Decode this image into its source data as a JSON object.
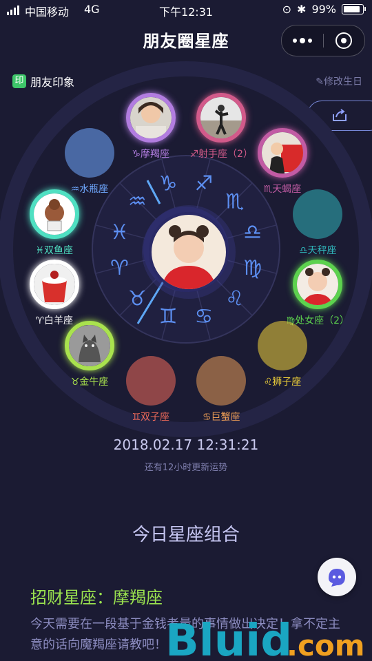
{
  "status": {
    "carrier": "中国移动",
    "network": "4G",
    "time": "下午12:31",
    "battery": "99%"
  },
  "nav": {
    "title": "朋友圈星座"
  },
  "header": {
    "impression_icon": "印",
    "impression_label": "朋友印象",
    "edit_birthday": "修改生日"
  },
  "wheel": {
    "inner_glyphs": [
      "♑",
      "♐",
      "♏",
      "♎",
      "♍",
      "♌",
      "♋",
      "♊",
      "♉",
      "♈",
      "♓",
      "♒"
    ],
    "signs": [
      {
        "key": "capricorn",
        "label": "♑摩羯座",
        "color": "#b27de0",
        "photo": "girl"
      },
      {
        "key": "sagittarius",
        "label": "♐射手座（2）",
        "color": "#d25a8a",
        "photo": "dance"
      },
      {
        "key": "scorpio",
        "label": "♏天蝎座",
        "color": "#c25ba4",
        "photo": "red"
      },
      {
        "key": "libra",
        "label": "♎天秤座",
        "color": "#2fb3b8",
        "photo": ""
      },
      {
        "key": "virgo",
        "label": "♍处女座（2）",
        "color": "#5dd24e",
        "photo": "red-girl"
      },
      {
        "key": "leo",
        "label": "♌狮子座",
        "color": "#f0d23a",
        "photo": ""
      },
      {
        "key": "cancer",
        "label": "♋巨蟹座",
        "color": "#e89a55",
        "photo": ""
      },
      {
        "key": "gemini",
        "label": "♊双子座",
        "color": "#ee6a5a",
        "photo": ""
      },
      {
        "key": "taurus",
        "label": "♉金牛座",
        "color": "#a9e24e",
        "photo": "cat"
      },
      {
        "key": "aries",
        "label": "♈白羊座",
        "color": "#ffffff",
        "photo": "cup"
      },
      {
        "key": "pisces",
        "label": "♓双鱼座",
        "color": "#4fe0c2",
        "photo": "hair"
      },
      {
        "key": "aquarius",
        "label": "♒水瓶座",
        "color": "#6fa8ff",
        "photo": ""
      }
    ]
  },
  "info": {
    "datetime": "2018.02.17 12:31:21",
    "update": "还有12小时更新运势"
  },
  "today": {
    "section_title": "今日星座组合",
    "fortune_title": "招财星座：摩羯座",
    "fortune_body": "今天需要在一段基于金钱考量的事情做出决定！拿不定主意的话向魔羯座请教吧！"
  },
  "watermark": {
    "text": "Bluid.com"
  }
}
